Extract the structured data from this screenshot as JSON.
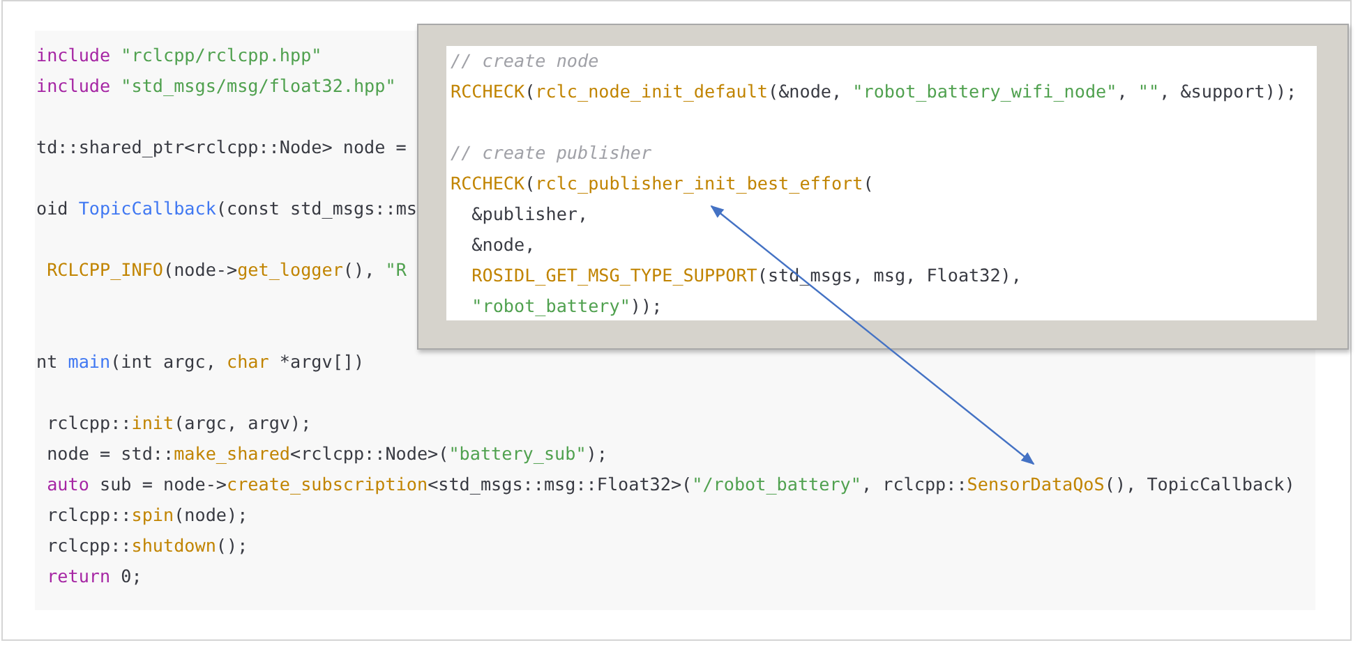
{
  "code_block": {
    "lines": [
      {
        "kind": "code",
        "tokens": [
          {
            "text": "include ",
            "kind": "keyword"
          },
          {
            "text": "\"rclcpp/rclcpp.hpp\"",
            "kind": "string"
          }
        ]
      },
      {
        "kind": "code",
        "tokens": [
          {
            "text": "include ",
            "kind": "keyword"
          },
          {
            "text": "\"std_msgs/msg/float32.hpp\"",
            "kind": "string"
          }
        ]
      },
      {
        "kind": "blank"
      },
      {
        "kind": "code",
        "tokens": [
          {
            "text": "td::shared_ptr<rclcpp::Node> node =",
            "kind": "plain"
          }
        ]
      },
      {
        "kind": "blank"
      },
      {
        "kind": "code",
        "tokens": [
          {
            "text": "oid ",
            "kind": "plain"
          },
          {
            "text": "TopicCallback",
            "kind": "function"
          },
          {
            "text": "(const std_msgs::ms",
            "kind": "plain"
          }
        ]
      },
      {
        "kind": "blank"
      },
      {
        "kind": "code",
        "tokens": [
          {
            "text": " RCLCPP_INFO",
            "kind": "call"
          },
          {
            "text": "(node->",
            "kind": "plain"
          },
          {
            "text": "get_logger",
            "kind": "call"
          },
          {
            "text": "(), ",
            "kind": "plain"
          },
          {
            "text": "\"R",
            "kind": "string"
          }
        ]
      },
      {
        "kind": "blank"
      },
      {
        "kind": "blank"
      },
      {
        "kind": "code",
        "tokens": [
          {
            "text": "nt ",
            "kind": "plain"
          },
          {
            "text": "main",
            "kind": "function"
          },
          {
            "text": "(int argc, ",
            "kind": "plain"
          },
          {
            "text": "char",
            "kind": "call"
          },
          {
            "text": " *argv[])",
            "kind": "plain"
          }
        ]
      },
      {
        "kind": "blank"
      },
      {
        "kind": "code",
        "tokens": [
          {
            "text": " rclcpp::",
            "kind": "plain"
          },
          {
            "text": "init",
            "kind": "call"
          },
          {
            "text": "(argc, argv);",
            "kind": "plain"
          }
        ]
      },
      {
        "kind": "code",
        "tokens": [
          {
            "text": " node = std::",
            "kind": "plain"
          },
          {
            "text": "make_shared",
            "kind": "call"
          },
          {
            "text": "<rclcpp::Node>(",
            "kind": "plain"
          },
          {
            "text": "\"battery_sub\"",
            "kind": "string"
          },
          {
            "text": ");",
            "kind": "plain"
          }
        ]
      },
      {
        "kind": "code",
        "tokens": [
          {
            "text": " auto",
            "kind": "keyword"
          },
          {
            "text": " sub = node->",
            "kind": "plain"
          },
          {
            "text": "create_subscription",
            "kind": "call"
          },
          {
            "text": "<std_msgs::msg::Float32>(",
            "kind": "plain"
          },
          {
            "text": "\"/robot_battery\"",
            "kind": "string"
          },
          {
            "text": ", rclcpp::",
            "kind": "plain"
          },
          {
            "text": "SensorDataQoS",
            "kind": "call"
          },
          {
            "text": "(), TopicCallback)",
            "kind": "plain"
          }
        ]
      },
      {
        "kind": "code",
        "tokens": [
          {
            "text": " rclcpp::",
            "kind": "plain"
          },
          {
            "text": "spin",
            "kind": "call"
          },
          {
            "text": "(node);",
            "kind": "plain"
          }
        ]
      },
      {
        "kind": "code",
        "tokens": [
          {
            "text": " rclcpp::",
            "kind": "plain"
          },
          {
            "text": "shutdown",
            "kind": "call"
          },
          {
            "text": "();",
            "kind": "plain"
          }
        ]
      },
      {
        "kind": "code",
        "tokens": [
          {
            "text": " return",
            "kind": "keyword"
          },
          {
            "text": " 0;",
            "kind": "plain"
          }
        ]
      }
    ]
  },
  "popup": {
    "lines": [
      {
        "kind": "code",
        "tokens": [
          {
            "text": "// create node",
            "kind": "comment"
          }
        ]
      },
      {
        "kind": "code",
        "tokens": [
          {
            "text": "RCCHECK",
            "kind": "call"
          },
          {
            "text": "(",
            "kind": "plain"
          },
          {
            "text": "rclc_node_init_default",
            "kind": "call"
          },
          {
            "text": "(&node, ",
            "kind": "plain"
          },
          {
            "text": "\"robot_battery_wifi_node\"",
            "kind": "string"
          },
          {
            "text": ", ",
            "kind": "plain"
          },
          {
            "text": "\"\"",
            "kind": "string"
          },
          {
            "text": ", &support));",
            "kind": "plain"
          }
        ]
      },
      {
        "kind": "blank"
      },
      {
        "kind": "code",
        "tokens": [
          {
            "text": "// create publisher",
            "kind": "comment"
          }
        ]
      },
      {
        "kind": "code",
        "tokens": [
          {
            "text": "RCCHECK",
            "kind": "call"
          },
          {
            "text": "(",
            "kind": "plain"
          },
          {
            "text": "rclc_publisher_init_best_effort",
            "kind": "call"
          },
          {
            "text": "(",
            "kind": "plain"
          }
        ]
      },
      {
        "kind": "code",
        "tokens": [
          {
            "text": "  &publisher,",
            "kind": "plain"
          }
        ]
      },
      {
        "kind": "code",
        "tokens": [
          {
            "text": "  &node,",
            "kind": "plain"
          }
        ]
      },
      {
        "kind": "code",
        "tokens": [
          {
            "text": "  ROSIDL_GET_MSG_TYPE_SUPPORT",
            "kind": "call"
          },
          {
            "text": "(std_msgs, msg, Float32),",
            "kind": "plain"
          }
        ]
      },
      {
        "kind": "code",
        "tokens": [
          {
            "text": "  \"robot_battery\"",
            "kind": "string"
          },
          {
            "text": "));",
            "kind": "plain"
          }
        ]
      }
    ]
  }
}
